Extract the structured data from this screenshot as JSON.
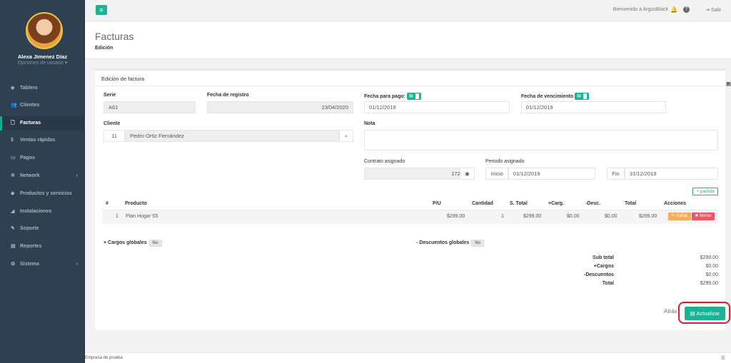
{
  "sidebar": {
    "user_name": "Alexa Jimenez Díaz",
    "user_options": "Opciones de usuario ▾",
    "items": [
      {
        "label": "Tablero",
        "icon": "dashboard-icon",
        "glyph": "◈"
      },
      {
        "label": "Clientes",
        "icon": "users-icon",
        "glyph": "👥"
      },
      {
        "label": "Facturas",
        "icon": "file-icon",
        "glyph": "🗋"
      },
      {
        "label": "Ventas rápidas",
        "icon": "dollar-icon",
        "glyph": "$"
      },
      {
        "label": "Pagos",
        "icon": "money-icon",
        "glyph": "▭"
      },
      {
        "label": "Network",
        "icon": "network-icon",
        "glyph": "✲"
      },
      {
        "label": "Productos y servicios",
        "icon": "tag-icon",
        "glyph": "◆"
      },
      {
        "label": "Instalaciones",
        "icon": "rocket-icon",
        "glyph": "◢"
      },
      {
        "label": "Soporte",
        "icon": "wrench-icon",
        "glyph": "✎"
      },
      {
        "label": "Reportes",
        "icon": "book-icon",
        "glyph": "▤"
      },
      {
        "label": "Sistema",
        "icon": "cogs-icon",
        "glyph": "⚙"
      }
    ]
  },
  "topbar": {
    "welcome": "Bienvenido a ArgusBlack",
    "logout": "Salir"
  },
  "header": {
    "title": "Facturas",
    "breadcrumb": "Edición"
  },
  "panel": {
    "title": "Edición de factura"
  },
  "form": {
    "serie_label": "Serie",
    "serie_value": "A61",
    "registro_label": "Fecha de registro",
    "registro_value": "23/04/2020",
    "pago_label": "Fecha para pago:",
    "pago_toggle": "Si",
    "pago_value": "01/12/2019",
    "venc_label": "Fecha de vencimiento",
    "venc_toggle": "Si",
    "venc_value": "01/12/2019",
    "cliente_label": "Cliente",
    "cliente_id": "11",
    "cliente_name": "Pedro Ortiz Fernández",
    "nota_label": "Nota",
    "contrato_label": "Contrato asignado",
    "contrato_value": "1729",
    "periodo_label": "Periodo asignado",
    "inicio_label": "Inicio",
    "inicio_value": "01/12/2019",
    "fin_label": "Fin",
    "fin_value": "31/12/2019"
  },
  "table": {
    "add_button": "+ partida",
    "headers": [
      "#",
      "Producto",
      "P/U",
      "Cantidad",
      "S. Total",
      "+Carg.",
      "-Desc.",
      "Total",
      "Acciones"
    ],
    "row": {
      "num": "1",
      "producto": "Plan Hogar S5",
      "pu": "$299.00",
      "cantidad": "1",
      "stotal": "$299.00",
      "carg": "$0.00",
      "desc": "$0.00",
      "total": "$299.00"
    },
    "edit_label": "Editar",
    "delete_label": "Borrar"
  },
  "globals": {
    "cargos_label": "+ Cargos globales",
    "cargos_value": "No",
    "desc_label": "- Descuentos globales",
    "desc_value": "No"
  },
  "summary": {
    "subtotal_label": "Sub total",
    "subtotal": "$299.00",
    "cargos_label": "+Cargos",
    "cargos": "$0.00",
    "desc_label": "-Descuentos",
    "desc": "$0.00",
    "total_label": "Total",
    "total": "$299.00"
  },
  "actions": {
    "back": "Atrás",
    "update": "Actualizar"
  },
  "footer": {
    "company": "Empresa de prueba"
  }
}
